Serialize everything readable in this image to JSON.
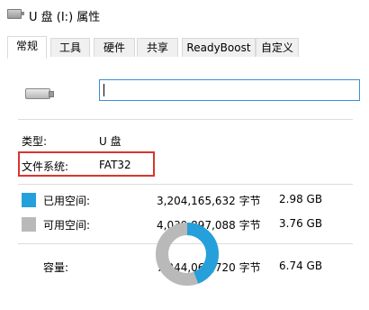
{
  "window": {
    "title": "U 盘 (I:) 属性",
    "icon": "usb-drive-icon"
  },
  "tabs": [
    {
      "label": "常规",
      "active": true
    },
    {
      "label": "工具",
      "active": false
    },
    {
      "label": "硬件",
      "active": false
    },
    {
      "label": "共享",
      "active": false
    },
    {
      "label": "ReadyBoost",
      "active": false
    },
    {
      "label": "自定义",
      "active": false
    }
  ],
  "general": {
    "drive_icon": "usb-drive-icon",
    "name_value": "",
    "type_label": "类型:",
    "type_value": "U 盘",
    "fs_label": "文件系统:",
    "fs_value": "FAT32",
    "used": {
      "label": "已用空间:",
      "bytes": "3,204,165,632 字节",
      "size": "2.98 GB",
      "color": "#26a0da"
    },
    "free": {
      "label": "可用空间:",
      "bytes": "4,039,897,088 字节",
      "size": "3.76 GB",
      "color": "#b9b9b9"
    },
    "capacity": {
      "label": "容量:",
      "bytes": "7,244,062,720 字节",
      "size": "6.74 GB"
    },
    "used_fraction": 0.4423
  },
  "colors": {
    "highlight_box": "#d9352e",
    "input_focus": "#3b8fd9"
  }
}
